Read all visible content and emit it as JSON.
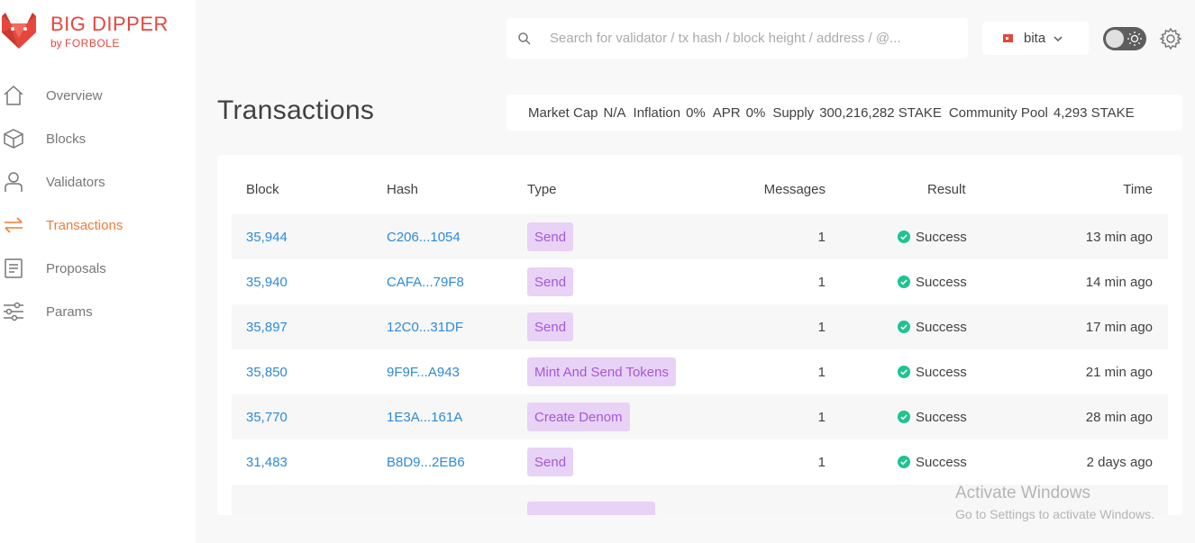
{
  "brand": {
    "title": "BIG DIPPER",
    "subtitle_by": "by ",
    "subtitle_name": "FORBOLE"
  },
  "nav": [
    {
      "label": "Overview",
      "icon": "home-icon"
    },
    {
      "label": "Blocks",
      "icon": "cube-icon"
    },
    {
      "label": "Validators",
      "icon": "person-icon"
    },
    {
      "label": "Transactions",
      "icon": "transfer-icon",
      "active": true
    },
    {
      "label": "Proposals",
      "icon": "document-icon"
    },
    {
      "label": "Params",
      "icon": "sliders-icon"
    }
  ],
  "search": {
    "placeholder": "Search for validator / tx hash / block height / address / @..."
  },
  "chain": {
    "name": "bita"
  },
  "page": {
    "title": "Transactions"
  },
  "market": {
    "market_cap_label": "Market Cap",
    "market_cap_value": "N/A",
    "inflation_label": "Inflation",
    "inflation_value": "0%",
    "apr_label": "APR",
    "apr_value": "0%",
    "supply_label": "Supply",
    "supply_value": "300,216,282 STAKE",
    "pool_label": "Community Pool",
    "pool_value": "4,293 STAKE"
  },
  "table": {
    "headers": {
      "block": "Block",
      "hash": "Hash",
      "type": "Type",
      "messages": "Messages",
      "result": "Result",
      "time": "Time"
    },
    "rows": [
      {
        "block": "35,944",
        "hash": "C206...1054",
        "type": "Send",
        "messages": "1",
        "result": "Success",
        "time": "13 min ago"
      },
      {
        "block": "35,940",
        "hash": "CAFA...79F8",
        "type": "Send",
        "messages": "1",
        "result": "Success",
        "time": "14 min ago"
      },
      {
        "block": "35,897",
        "hash": "12C0...31DF",
        "type": "Send",
        "messages": "1",
        "result": "Success",
        "time": "17 min ago"
      },
      {
        "block": "35,850",
        "hash": "9F9F...A943",
        "type": "Mint And Send Tokens",
        "messages": "1",
        "result": "Success",
        "time": "21 min ago"
      },
      {
        "block": "35,770",
        "hash": "1E3A...161A",
        "type": "Create Denom",
        "messages": "1",
        "result": "Success",
        "time": "28 min ago"
      },
      {
        "block": "31,483",
        "hash": "B8D9...2EB6",
        "type": "Send",
        "messages": "1",
        "result": "Success",
        "time": "2 days ago"
      }
    ]
  },
  "watermark": {
    "line1": "Activate Windows",
    "line2": "Go to Settings to activate Windows."
  },
  "colors": {
    "accent": "#e6463c",
    "active_nav": "#f07a3c",
    "link": "#2e8ad8",
    "badge_bg": "#e8d2f5",
    "badge_text": "#a35ad6",
    "success": "#1ec490"
  }
}
